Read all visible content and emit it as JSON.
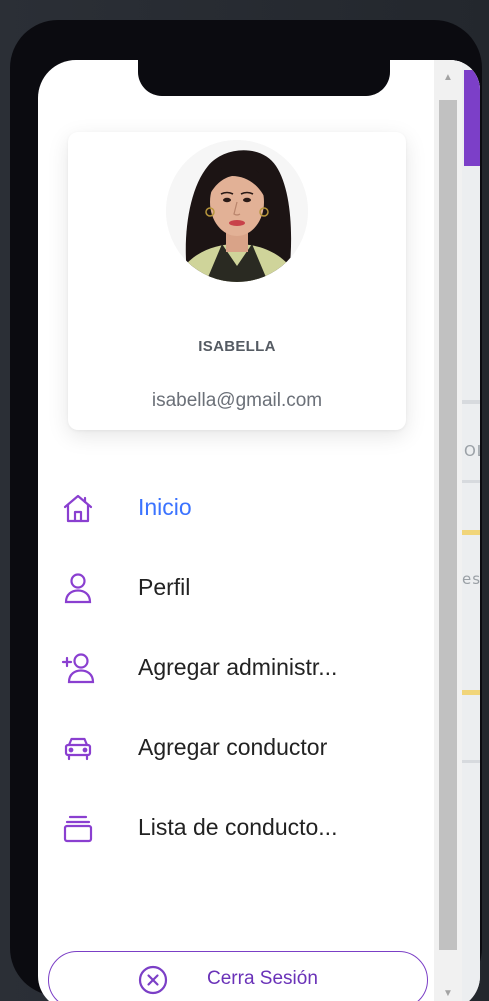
{
  "user": {
    "name": "ISABELLA",
    "email": "isabella@gmail.com"
  },
  "menu": {
    "items": [
      {
        "label": "Inicio",
        "icon": "home-icon",
        "active": true
      },
      {
        "label": "Perfil",
        "icon": "user-icon",
        "active": false
      },
      {
        "label": "Agregar administr...",
        "icon": "add-user-icon",
        "active": false
      },
      {
        "label": "Agregar conductor",
        "icon": "car-icon",
        "active": false
      },
      {
        "label": "Lista de conducto...",
        "icon": "stack-icon",
        "active": false
      }
    ]
  },
  "logout": {
    "label": "Cerra Sesión",
    "icon": "close-circle-icon"
  },
  "map": {
    "labels": [
      "OL",
      "es"
    ]
  },
  "colors": {
    "accent": "#7b3fc6",
    "active": "#3b73ff",
    "icon": "#8a3fd0"
  }
}
